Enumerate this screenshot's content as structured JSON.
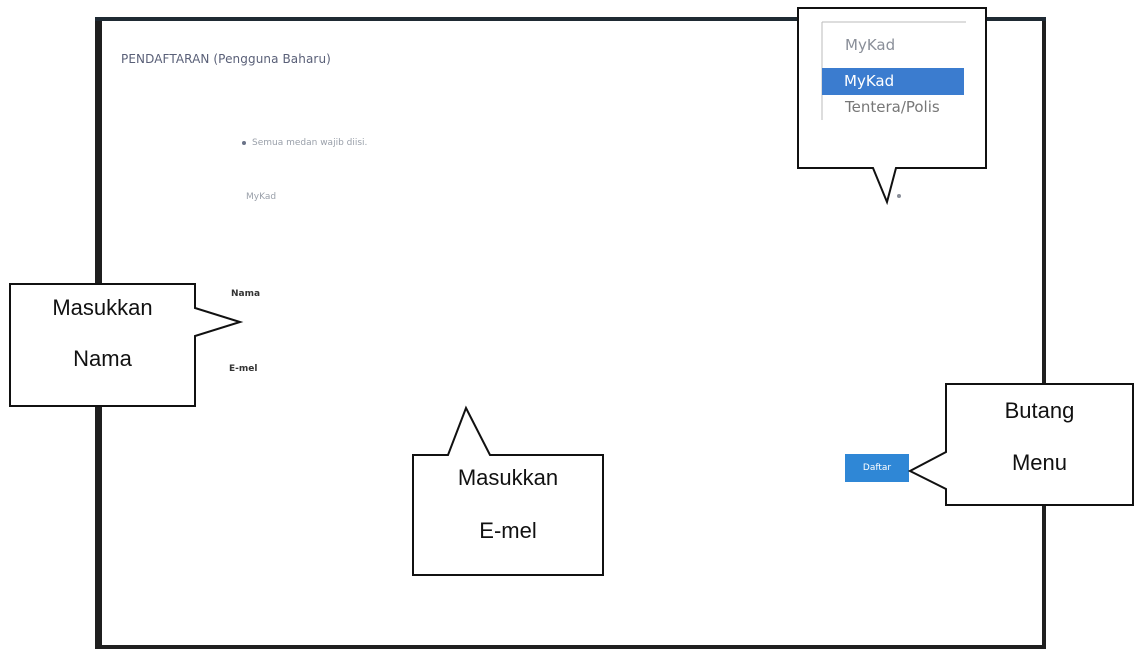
{
  "form": {
    "title": "PENDAFTARAN (Pengguna Baharu)",
    "required_notice": "Semua medan wajib diisi.",
    "id_type_select_value": "MyKad",
    "name_label": "Nama",
    "email_label": "E-mel",
    "submit_label": "Daftar"
  },
  "dropdown": {
    "current": "MyKad",
    "options": [
      "MyKad",
      "Tentera/Polis"
    ],
    "selected_index": 0
  },
  "callouts": {
    "name_line1": "Masukkan",
    "name_line2": "Nama",
    "email_line1": "Masukkan",
    "email_line2": "E-mel",
    "button_line1": "Butang",
    "button_line2": "Menu"
  },
  "colors": {
    "button": "#2f87d6",
    "selected_option": "#3b7ccf",
    "frame": "#1f1f1f"
  }
}
